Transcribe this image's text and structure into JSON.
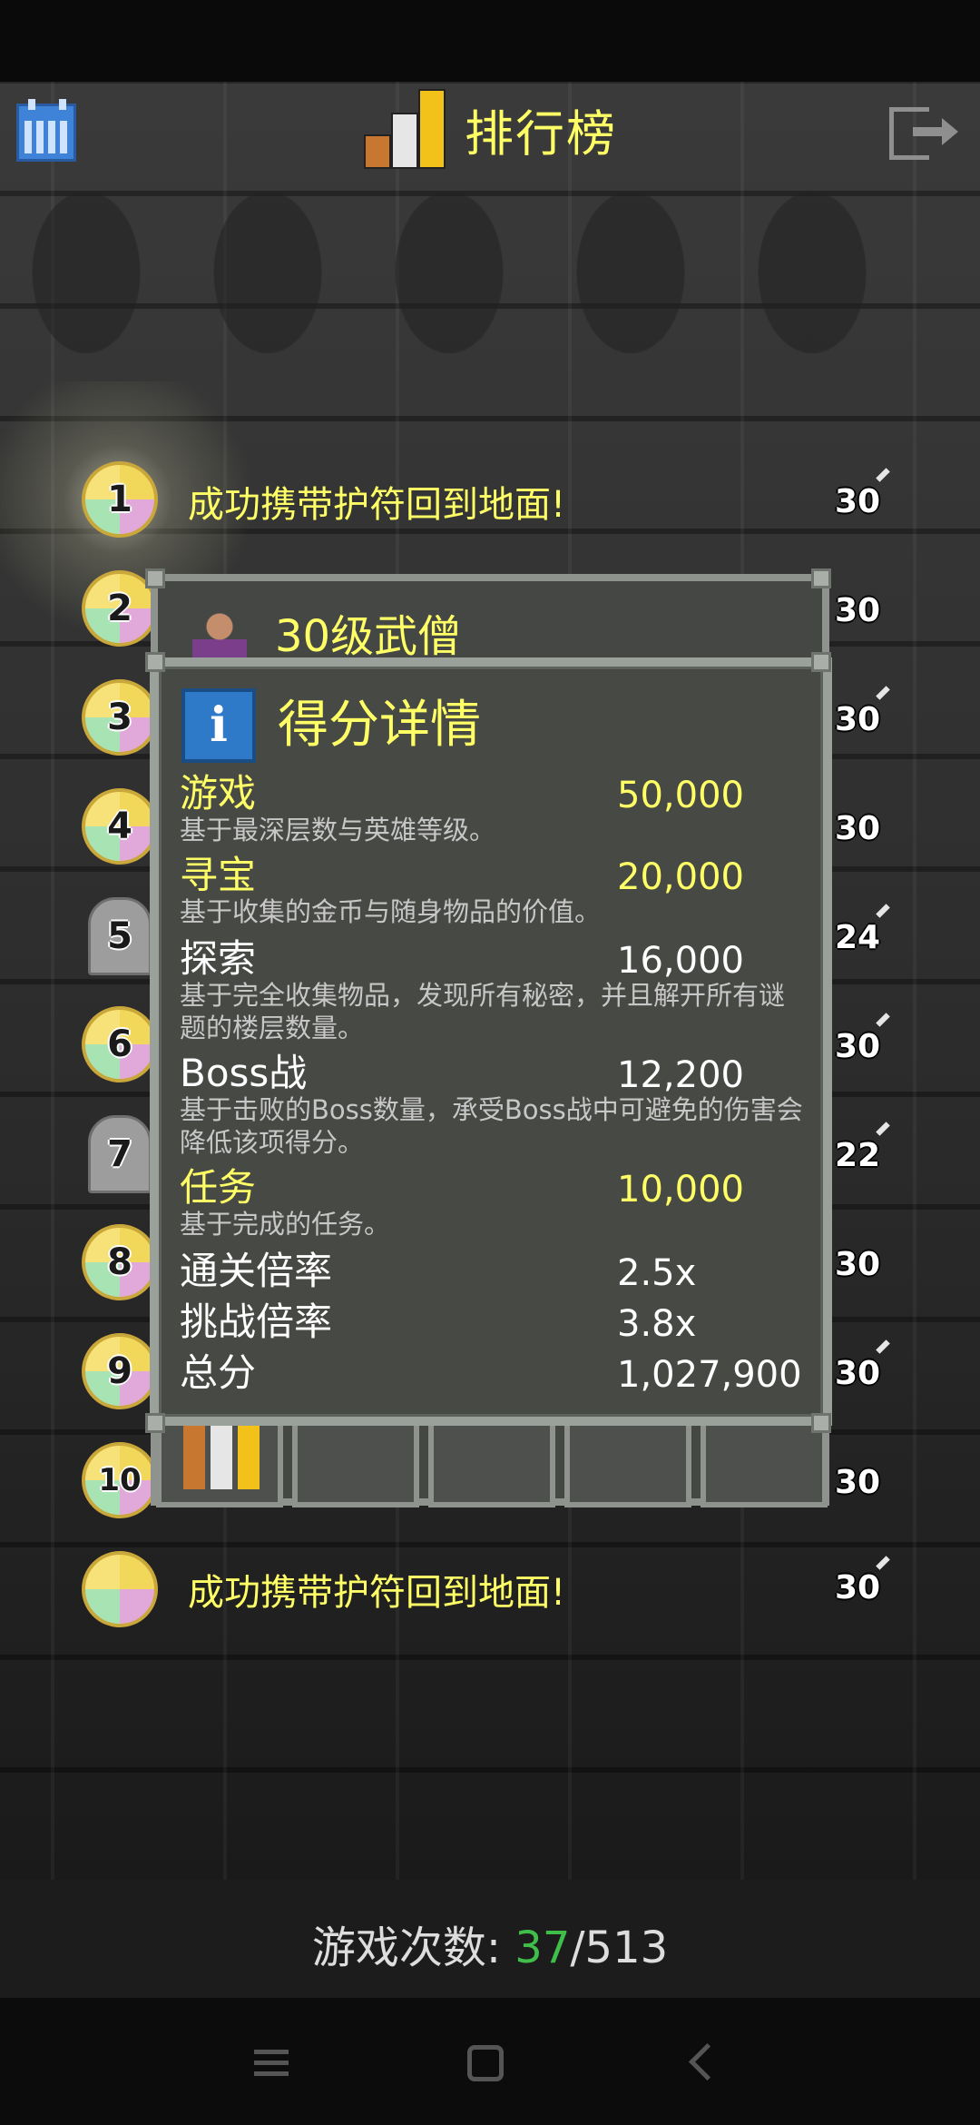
{
  "header": {
    "title": "排行榜",
    "calendar_icon": "calendar-icon",
    "rankings_icon": "bar-chart-icon",
    "exit_icon": "exit-icon"
  },
  "leaderboard": {
    "rows": [
      {
        "rank": "1",
        "text": "成功携带护符回到地面!",
        "level": "30",
        "badge": "gold"
      },
      {
        "rank": "2",
        "text": "",
        "level": "30",
        "badge": "gold"
      },
      {
        "rank": "3",
        "text": "",
        "level": "30",
        "badge": "gold"
      },
      {
        "rank": "4",
        "text": "",
        "level": "30",
        "badge": "gold"
      },
      {
        "rank": "5",
        "text": "",
        "level": "24",
        "badge": "tombstone"
      },
      {
        "rank": "6",
        "text": "",
        "level": "30",
        "badge": "gold"
      },
      {
        "rank": "7",
        "text": "",
        "level": "22",
        "badge": "tombstone"
      },
      {
        "rank": "8",
        "text": "",
        "level": "30",
        "badge": "gold"
      },
      {
        "rank": "9",
        "text": "",
        "level": "30",
        "badge": "gold"
      },
      {
        "rank": "10",
        "text": "",
        "level": "30",
        "badge": "gold"
      }
    ],
    "current_run": {
      "text": "成功携带护符回到地面!",
      "level": "30"
    }
  },
  "record_panel": {
    "title": "30级武僧"
  },
  "score_dialog": {
    "title": "得分详情",
    "categories": [
      {
        "name": "游戏",
        "score": "50,000",
        "desc": "基于最深层数与英雄等级。"
      },
      {
        "name": "寻宝",
        "score": "20,000",
        "desc": "基于收集的金币与随身物品的价值。"
      },
      {
        "name": "探索",
        "score": "16,000",
        "desc": "基于完全收集物品，发现所有秘密，并且解开所有谜题的楼层数量。"
      },
      {
        "name": "Boss战",
        "score": "12,200",
        "desc": "基于击败的Boss数量，承受Boss战中可避免的伤害会降低该项得分。"
      },
      {
        "name": "任务",
        "score": "10,000",
        "desc": "基于完成的任务。"
      }
    ],
    "multipliers": [
      {
        "name": "通关倍率",
        "value": "2.5x"
      },
      {
        "name": "挑战倍率",
        "value": "3.8x"
      },
      {
        "name": "总分",
        "value": "1,027,900"
      }
    ]
  },
  "footer": {
    "label": "游戏次数: ",
    "played": "37",
    "separator": "/",
    "total": "513"
  },
  "colors": {
    "title_yellow": "#ffff66",
    "played_green": "#3fbf4a",
    "dialog_bg": "#474945",
    "dialog_border": "#9aa09a"
  }
}
